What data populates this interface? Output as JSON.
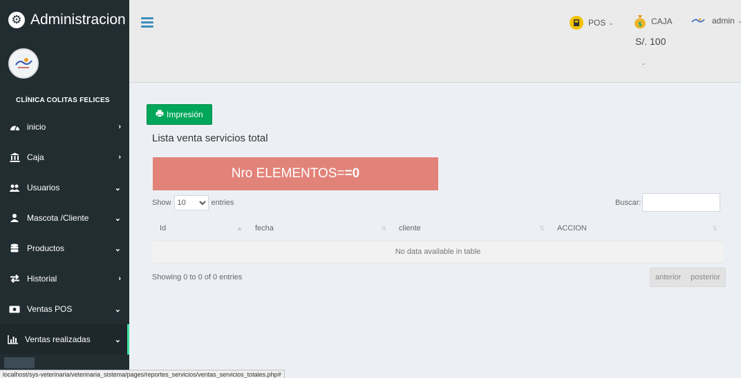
{
  "sidebar": {
    "brand": "Administracion",
    "clinic_name": "CLÍNICA COLITAS FELICES",
    "items": [
      {
        "label": "inicio",
        "icon": "dashboard-icon",
        "arrow": "›"
      },
      {
        "label": "Caja",
        "icon": "bank-icon",
        "arrow": "›"
      },
      {
        "label": "Usuarios",
        "icon": "users-icon",
        "arrow": "⌄"
      },
      {
        "label": "Mascota /Cliente",
        "icon": "user-pet-icon",
        "arrow": "⌄"
      },
      {
        "label": "Productos",
        "icon": "database-icon",
        "arrow": "⌄"
      },
      {
        "label": "Historial",
        "icon": "exchange-icon",
        "arrow": "›"
      },
      {
        "label": "Ventas POS",
        "icon": "money-icon",
        "arrow": "⌄"
      },
      {
        "label": "Ventas realizadas",
        "icon": "bar-chart-icon",
        "arrow": "⌄"
      }
    ]
  },
  "header": {
    "pos_label": "POS",
    "caja_label": "CAJA",
    "caja_amount": "S/. 100",
    "user_label": "admin"
  },
  "content": {
    "print_button": "Impresión",
    "title": "Lista venta servicios total",
    "count_label": "Nro ELEMENTOS= ",
    "count_value": "=0",
    "length_prefix": "Show",
    "length_value": "10",
    "length_suffix": "entries",
    "search_label": "Buscar:",
    "search_value": "",
    "columns": [
      "Id",
      "fecha",
      "cliente",
      "ACCION"
    ],
    "empty_message": "No data available in table",
    "info": "Showing 0 to 0 of 0 entries",
    "pager_prev": "anterior",
    "pager_next": "posterior"
  },
  "status_url": "localhost/sys-veterinaria/veterinaria_sistema/pages/reportes_servicios/ventas_servicios_totales.php#",
  "colors": {
    "sidebar": "#222d32",
    "header": "#ebebeb",
    "body": "#ecf0f5",
    "print_button": "#00a65a",
    "count_box": "#e2837a",
    "active_indicator": "#3ee0a0",
    "hamburger": "#3c8dbc"
  }
}
